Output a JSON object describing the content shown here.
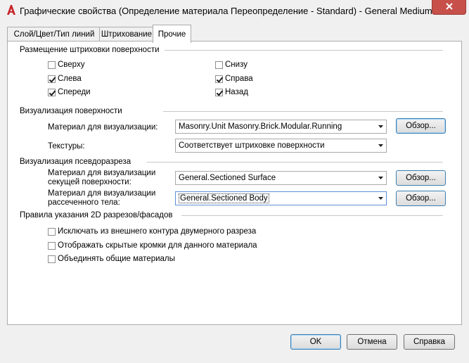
{
  "window": {
    "title": "Графические свойства (Определение материала Переопределение - Standard) - General Medium Detail",
    "app_icon": "autocad-logo-icon",
    "close_icon": "close-icon"
  },
  "tabs": [
    {
      "label": "Слой/Цвет/Тип линий",
      "active": false
    },
    {
      "label": "Штрихование",
      "active": false
    },
    {
      "label": "Прочие",
      "active": true
    }
  ],
  "surface_hatch": {
    "title": "Размещение штриховки поверхности",
    "options": [
      {
        "label": "Сверху",
        "checked": false
      },
      {
        "label": "Снизу",
        "checked": false
      },
      {
        "label": "Слева",
        "checked": true
      },
      {
        "label": "Справа",
        "checked": true
      },
      {
        "label": "Спереди",
        "checked": true
      },
      {
        "label": "Назад",
        "checked": true
      }
    ]
  },
  "surface_render": {
    "title": "Визуализация поверхности",
    "material_label": "Материал для визуализации:",
    "material_value": "Masonry.Unit Masonry.Brick.Modular.Running",
    "browse_label": "Обзор...",
    "textures_label": "Текстуры:",
    "textures_value": "Соответствует штриховке поверхности"
  },
  "pseudo_section": {
    "title": "Визуализация псевдоразреза",
    "cut_surface_label_1": "Материал для визуализации",
    "cut_surface_label_2": "секущей поверхности:",
    "cut_surface_value": "General.Sectioned Surface",
    "cut_body_label_1": "Материал для визуализации",
    "cut_body_label_2": "рассеченного тела:",
    "cut_body_value": "General.Sectioned Body",
    "browse_label": "Обзор..."
  },
  "rules_2d": {
    "title": "Правила указания 2D разрезов/фасадов",
    "options": [
      {
        "label": "Исключать из внешнего контура двумерного разреза",
        "checked": false
      },
      {
        "label": "Отображать скрытые кромки для данного материала",
        "checked": false
      },
      {
        "label": "Объединять общие материалы",
        "checked": false
      }
    ]
  },
  "footer": {
    "ok": "OK",
    "cancel": "Отмена",
    "help": "Справка"
  },
  "colors": {
    "close_button": "#c7504a",
    "accent_border": "#3c7fb1",
    "panel_bg": "#ffffff",
    "window_bg": "#f0f0f0"
  }
}
